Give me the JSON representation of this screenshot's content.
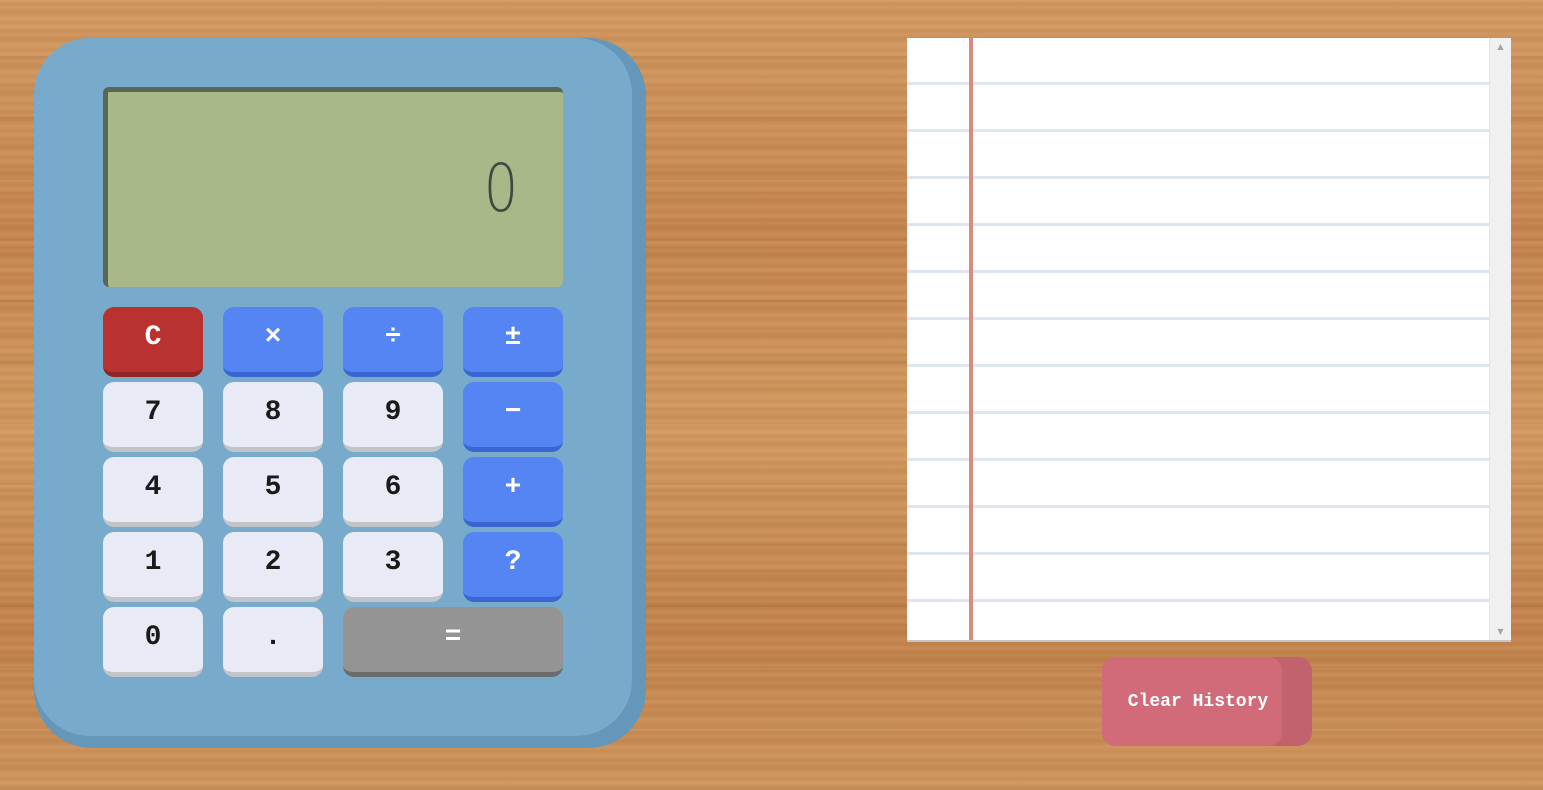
{
  "calculator": {
    "display_value": "0",
    "keys": {
      "clear": "C",
      "multiply": "×",
      "divide": "÷",
      "plus_minus": "±",
      "seven": "7",
      "eight": "8",
      "nine": "9",
      "minus": "−",
      "four": "4",
      "five": "5",
      "six": "6",
      "plus": "+",
      "one": "1",
      "two": "2",
      "three": "3",
      "unknown": "?",
      "zero": "0",
      "decimal": ".",
      "equals": "="
    }
  },
  "history": {
    "entries": []
  },
  "clear_history_label": "Clear History",
  "colors": {
    "calculator_body": "#78abcb",
    "display": "#a9b889",
    "number_key": "#e8eaf6",
    "operator_key": "#5585f2",
    "clear_key": "#b9322f",
    "equals_key": "#949494",
    "clear_history_button": "#d16b7a",
    "notepad_margin": "#d98b7e"
  }
}
